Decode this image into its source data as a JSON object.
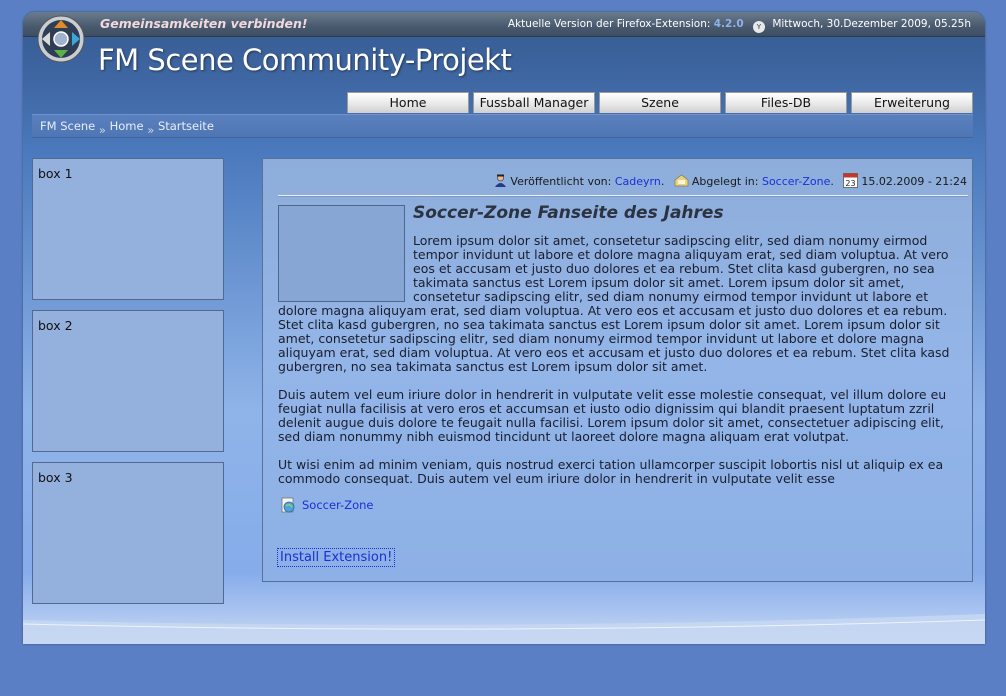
{
  "header": {
    "slogan": "Gemeinsamkeiten verbinden!",
    "version_prefix": "Aktuelle Version der Firefox-Extension:",
    "version_number": "4.2.0",
    "date": "Mittwoch, 30.Dezember 2009, 05.25h",
    "site_title": "FM Scene Community-Projekt"
  },
  "nav": {
    "items": [
      {
        "label": "Home"
      },
      {
        "label": "Fussball Manager"
      },
      {
        "label": "Szene"
      },
      {
        "label": "Files-DB"
      },
      {
        "label": "Erweiterung"
      }
    ]
  },
  "breadcrumb": {
    "items": [
      "FM Scene",
      "Home",
      "Startseite"
    ],
    "separator": "»"
  },
  "sidebar": {
    "boxes": [
      {
        "title": "box 1"
      },
      {
        "title": "box 2"
      },
      {
        "title": "box 3"
      }
    ]
  },
  "article": {
    "meta": {
      "published_label": "Veröffentlicht von:",
      "author": "Cadeyrn",
      "filed_label": "Abgelegt in:",
      "category": "Soccer-Zone",
      "calendar_day": "23",
      "datetime": "15.02.2009 - 21:24"
    },
    "title": "Soccer-Zone Fanseite des Jahres",
    "paragraphs": [
      "Lorem ipsum dolor sit amet, consetetur sadipscing elitr, sed diam nonumy eirmod tempor invidunt ut labore et dolore magna aliquyam erat, sed diam voluptua. At vero eos et accusam et justo duo dolores et ea rebum. Stet clita kasd gubergren, no sea takimata sanctus est Lorem ipsum dolor sit amet. Lorem ipsum dolor sit amet, consetetur sadipscing elitr, sed diam nonumy eirmod tempor invidunt ut labore et dolore magna aliquyam erat, sed diam voluptua. At vero eos et accusam et justo duo dolores et ea rebum. Stet clita kasd gubergren, no sea takimata sanctus est Lorem ipsum dolor sit amet. Lorem ipsum dolor sit amet, consetetur sadipscing elitr, sed diam nonumy eirmod tempor invidunt ut labore et dolore magna aliquyam erat, sed diam voluptua. At vero eos et accusam et justo duo dolores et ea rebum. Stet clita kasd gubergren, no sea takimata sanctus est Lorem ipsum dolor sit amet.",
      "Duis autem vel eum iriure dolor in hendrerit in vulputate velit esse molestie consequat, vel illum dolore eu feugiat nulla facilisis at vero eros et accumsan et iusto odio dignissim qui blandit praesent luptatum zzril delenit augue duis dolore te feugait nulla facilisi. Lorem ipsum dolor sit amet, consectetuer adipiscing elit, sed diam nonummy nibh euismod tincidunt ut laoreet dolore magna aliquam erat volutpat.",
      "Ut wisi enim ad minim veniam, quis nostrud exerci tation ullamcorper suscipit lobortis nisl ut aliquip ex ea commodo consequat. Duis autem vel eum iriure dolor in hendrerit in vulputate velit esse"
    ],
    "link_label": "Soccer-Zone",
    "install_button": "Install Extension!"
  }
}
